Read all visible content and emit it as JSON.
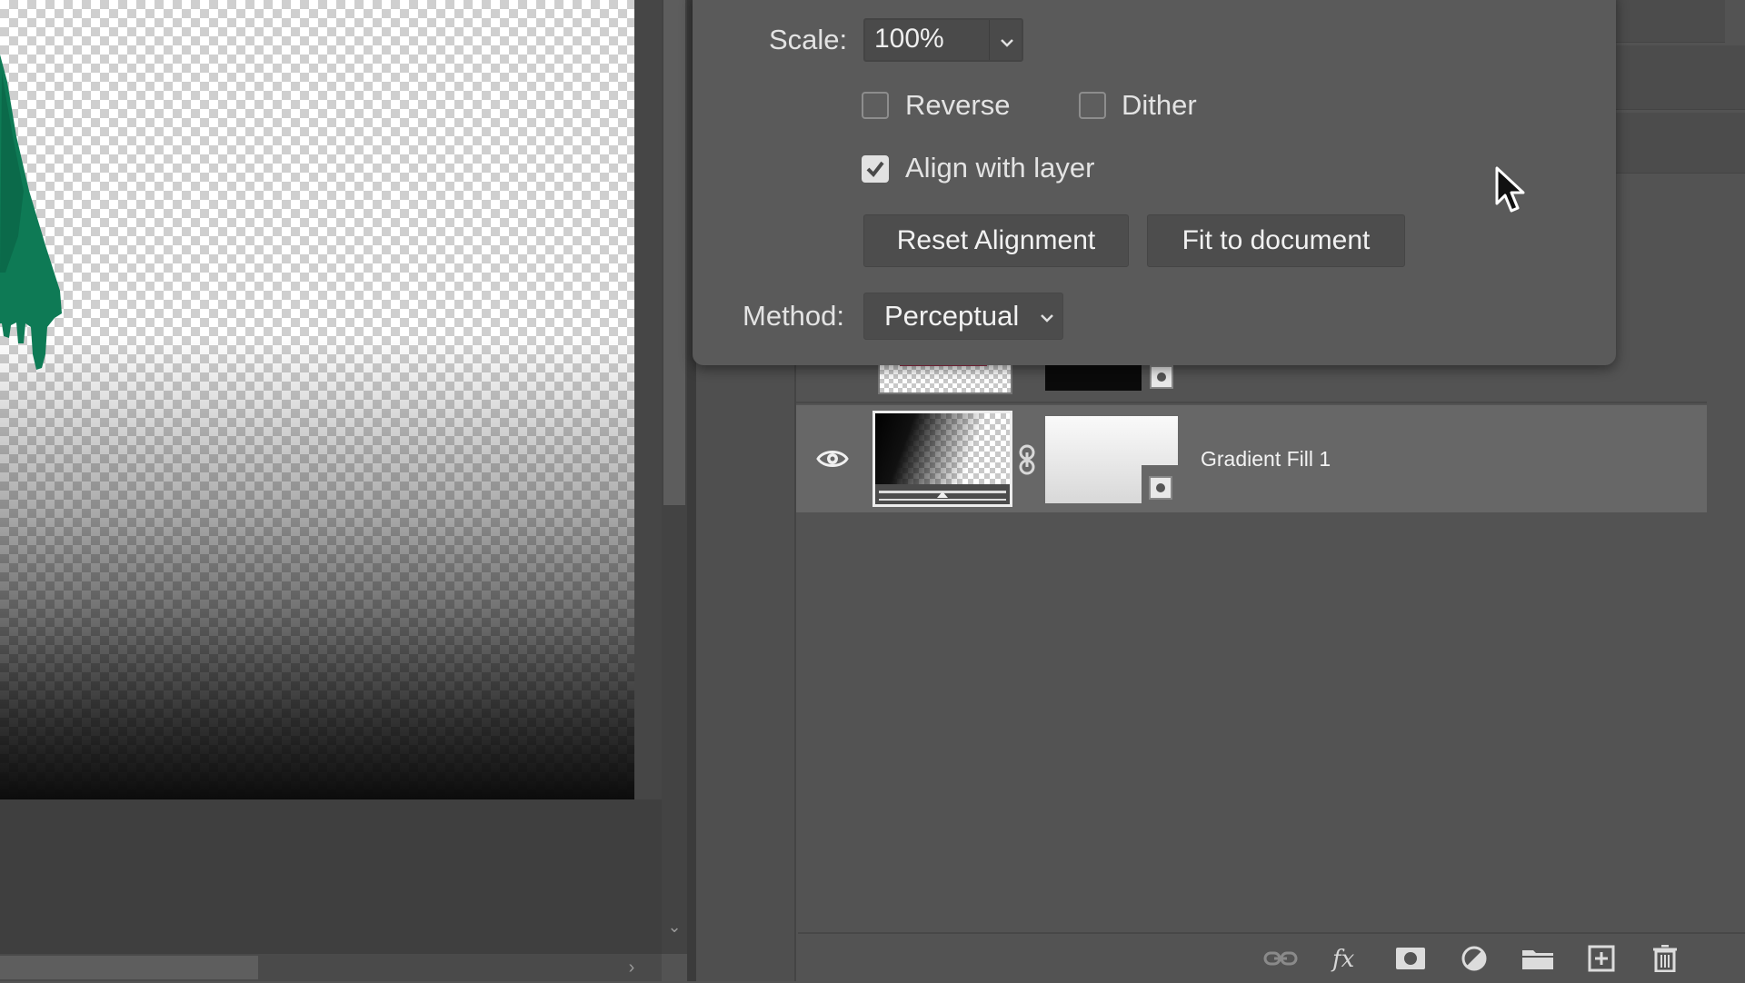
{
  "gradient_options": {
    "scale_label": "Scale:",
    "scale_value": "100%",
    "reverse_label": "Reverse",
    "reverse_checked": false,
    "dither_label": "Dither",
    "dither_checked": false,
    "align_label": "Align with layer",
    "align_checked": true,
    "reset_alignment_label": "Reset Alignment",
    "fit_to_document_label": "Fit to document",
    "method_label": "Method:",
    "method_value": "Perceptual"
  },
  "layers": {
    "rows": [
      {
        "name": "",
        "visible": true
      },
      {
        "name": "Gradient Fill 1",
        "visible": true,
        "selected": true
      }
    ]
  },
  "footer_icons": [
    "link-layers-icon",
    "fx-icon",
    "add-mask-icon",
    "adjustment-layer-icon",
    "folder-icon",
    "new-layer-icon",
    "trash-icon"
  ],
  "colors": {
    "panel_bg": "#535353",
    "selected_row": "#676767",
    "popover_bg": "#5a5a5a",
    "paint_green": "#0e7a55"
  }
}
